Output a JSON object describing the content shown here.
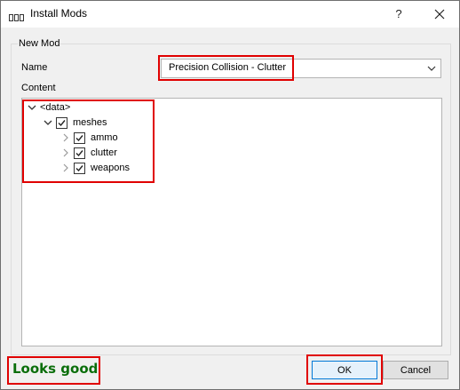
{
  "window": {
    "title": "Install Mods",
    "help_label": "?"
  },
  "group": {
    "title": "New Mod"
  },
  "name_field": {
    "label": "Name",
    "value": "Precision Collision - Clutter"
  },
  "content": {
    "label": "Content",
    "tree": {
      "root": "<data>",
      "folder": "meshes",
      "children": [
        "ammo",
        "clutter",
        "weapons"
      ]
    }
  },
  "status": {
    "message": "Looks good",
    "color": "#0a6e0a"
  },
  "buttons": {
    "ok": "OK",
    "cancel": "Cancel"
  },
  "highlight_color": "#e00000"
}
